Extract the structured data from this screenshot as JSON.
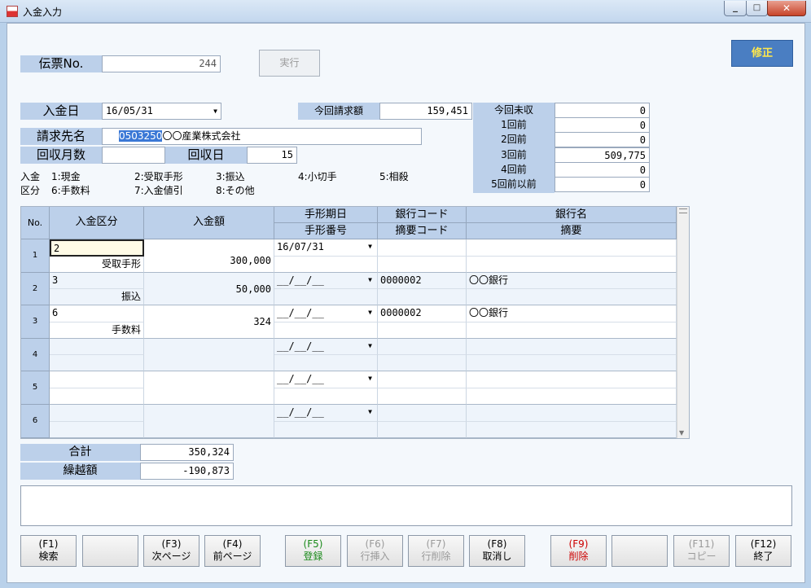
{
  "window": {
    "title": "入金入力"
  },
  "header": {
    "denpyo_label": "伝票No.",
    "denpyo_value": "244",
    "execute_label": "実行",
    "mode_label": "修正"
  },
  "form": {
    "nyukin_date_label": "入金日",
    "nyukin_date_value": "16/05/31",
    "seikyu_label": "請求先名",
    "seikyu_code": "0503250",
    "seikyu_name": "〇〇産業株式会社",
    "kaishu_months_label": "回収月数",
    "kaishu_months_value": "",
    "kaishu_day_label": "回収日",
    "kaishu_day_value": "15",
    "konkai_seikyu_label": "今回請求額",
    "konkai_seikyu_value": "159,451"
  },
  "unpaid": {
    "items": [
      {
        "label": "今回未収",
        "value": "0"
      },
      {
        "label": "1回前",
        "value": "0"
      },
      {
        "label": "2回前",
        "value": "0"
      },
      {
        "label": "3回前",
        "value": "509,775"
      },
      {
        "label": "4回前",
        "value": "0"
      },
      {
        "label": "5回前以前",
        "value": "0"
      }
    ]
  },
  "legend": {
    "row1_prefix": "入金",
    "row2_prefix": "区分",
    "row1": [
      "1:現金",
      "2:受取手形",
      "3:振込",
      "4:小切手",
      "5:相殺"
    ],
    "row2": [
      "6:手数料",
      "7:入金値引",
      "8:その他"
    ]
  },
  "grid": {
    "headers": {
      "no": "No.",
      "kubun": "入金区分",
      "amount": "入金額",
      "tegata_date": "手形期日",
      "tegata_no": "手形番号",
      "bank_code": "銀行コード",
      "tekiyo_code": "摘要コード",
      "bank_name": "銀行名",
      "tekiyo": "摘要"
    },
    "rows": [
      {
        "no": "1",
        "kubun_code": "2",
        "kubun_name": "受取手形",
        "amount": "300,000",
        "date": "16/07/31",
        "bank_code": "",
        "bank_name": ""
      },
      {
        "no": "2",
        "kubun_code": "3",
        "kubun_name": "振込",
        "amount": "50,000",
        "date": "__/__/__",
        "bank_code": "0000002",
        "bank_name": "〇〇銀行"
      },
      {
        "no": "3",
        "kubun_code": "6",
        "kubun_name": "手数料",
        "amount": "324",
        "date": "__/__/__",
        "bank_code": "0000002",
        "bank_name": "〇〇銀行"
      },
      {
        "no": "4",
        "kubun_code": "",
        "kubun_name": "",
        "amount": "",
        "date": "__/__/__",
        "bank_code": "",
        "bank_name": ""
      },
      {
        "no": "5",
        "kubun_code": "",
        "kubun_name": "",
        "amount": "",
        "date": "__/__/__",
        "bank_code": "",
        "bank_name": ""
      },
      {
        "no": "6",
        "kubun_code": "",
        "kubun_name": "",
        "amount": "",
        "date": "__/__/__",
        "bank_code": "",
        "bank_name": ""
      }
    ]
  },
  "totals": {
    "total_label": "合計",
    "total_value": "350,324",
    "carry_label": "繰越額",
    "carry_value": "-190,873"
  },
  "fkeys": [
    {
      "key": "(F1)",
      "label": "検索",
      "state": "normal"
    },
    {
      "key": "",
      "label": "",
      "state": "normal"
    },
    {
      "key": "(F3)",
      "label": "次ページ",
      "state": "normal"
    },
    {
      "key": "(F4)",
      "label": "前ページ",
      "state": "normal"
    },
    {
      "key": "(F5)",
      "label": "登録",
      "state": "green"
    },
    {
      "key": "(F6)",
      "label": "行挿入",
      "state": "dis"
    },
    {
      "key": "(F7)",
      "label": "行削除",
      "state": "dis"
    },
    {
      "key": "(F8)",
      "label": "取消し",
      "state": "normal"
    },
    {
      "key": "(F9)",
      "label": "削除",
      "state": "red"
    },
    {
      "key": "",
      "label": "",
      "state": "normal"
    },
    {
      "key": "(F11)",
      "label": "コピー",
      "state": "dis"
    },
    {
      "key": "(F12)",
      "label": "終了",
      "state": "normal"
    }
  ]
}
